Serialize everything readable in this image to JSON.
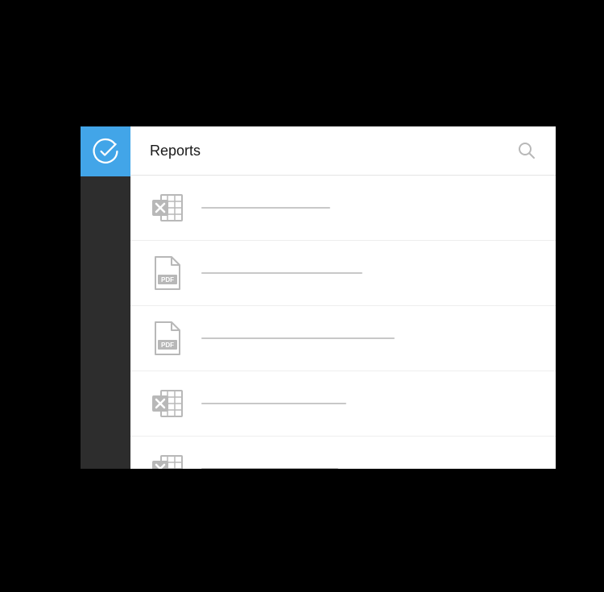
{
  "header": {
    "title": "Reports"
  },
  "colors": {
    "accent": "#42a5e8",
    "sidebar": "#2d2d2d",
    "icon_muted": "#b8b8b8",
    "placeholder": "#c8c8c8",
    "divider": "#e5e5e5"
  },
  "reports": [
    {
      "type": "excel",
      "placeholder_width": 160
    },
    {
      "type": "pdf",
      "placeholder_width": 200
    },
    {
      "type": "pdf",
      "placeholder_width": 240
    },
    {
      "type": "excel",
      "placeholder_width": 180
    },
    {
      "type": "excel",
      "placeholder_width": 170
    }
  ]
}
